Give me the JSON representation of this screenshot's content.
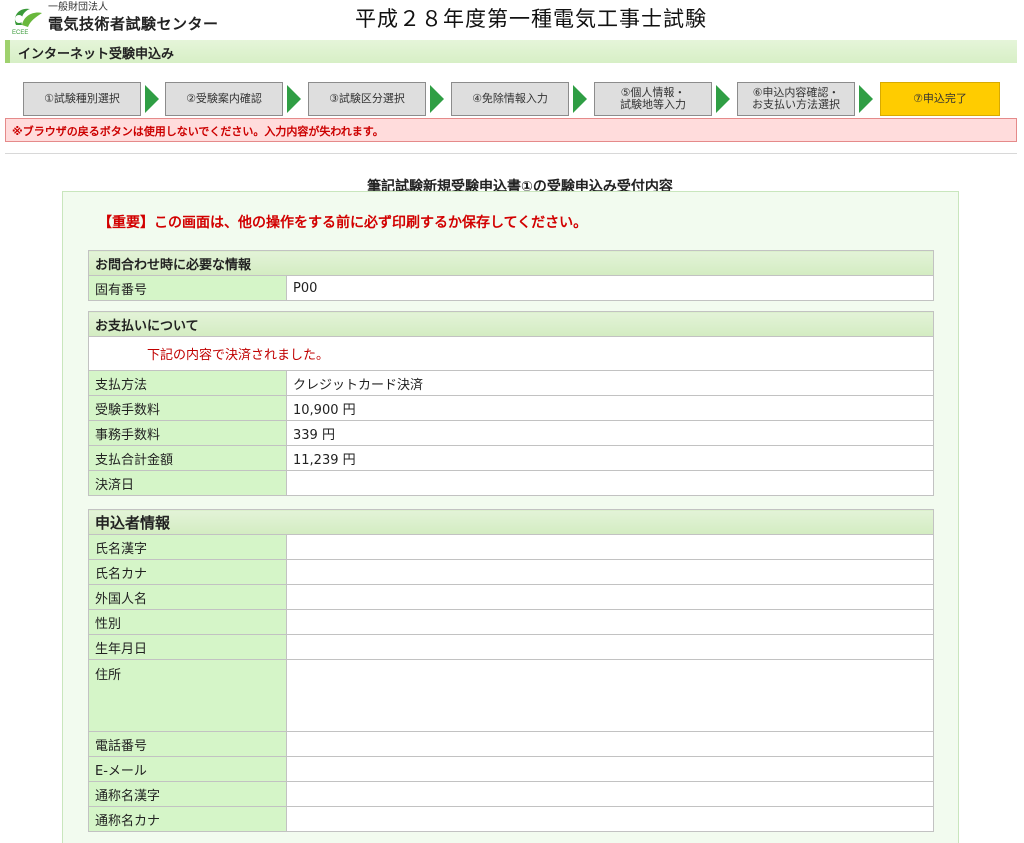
{
  "header": {
    "org_sub": "一般財団法人",
    "org_name": "電気技術者試験センター",
    "exam_title": "平成２８年度第一種電気工事士試験",
    "colors": {
      "brand_green": "#3a9a3a"
    }
  },
  "section": {
    "title": "インターネット受験申込み"
  },
  "steps": [
    {
      "label": "①試験種別選択"
    },
    {
      "label": "②受験案内確認"
    },
    {
      "label": "③試験区分選択"
    },
    {
      "label": "④免除情報入力"
    },
    {
      "label": "⑤個人情報・\n試験地等入力"
    },
    {
      "label": "⑥申込内容確認・\nお支払い方法選択"
    },
    {
      "label": "⑦申込完了"
    }
  ],
  "warning": "※ブラウザの戻るボタンは使用しないでください。入力内容が失われます。",
  "receipt_title": "筆記試験新規受験申込書①の受験申込み受付内容",
  "important": "【重要】この画面は、他の操作をする前に必ず印刷するか保存してください。",
  "contact": {
    "heading": "お問合わせ時に必要な情報",
    "id_label": "固有番号",
    "id_value": "P00"
  },
  "payment": {
    "heading": "お支払いについて",
    "notice": "下記の内容で決済されました。",
    "rows": [
      {
        "label": "支払方法",
        "value": "クレジットカード決済"
      },
      {
        "label": "受験手数料",
        "value": "10,900 円"
      },
      {
        "label": "事務手数料",
        "value": "339 円"
      },
      {
        "label": "支払合計金額",
        "value": "11,239 円"
      },
      {
        "label": "決済日",
        "value": ""
      }
    ]
  },
  "applicant": {
    "heading": "申込者情報",
    "rows": [
      {
        "label": "氏名漢字",
        "value": ""
      },
      {
        "label": "氏名カナ",
        "value": ""
      },
      {
        "label": "外国人名",
        "value": ""
      },
      {
        "label": "性別",
        "value": ""
      },
      {
        "label": "生年月日",
        "value": ""
      },
      {
        "label": "住所",
        "value": ""
      },
      {
        "label": "電話番号",
        "value": ""
      },
      {
        "label": "E-メール",
        "value": ""
      },
      {
        "label": "通称名漢字",
        "value": ""
      },
      {
        "label": "通称名カナ",
        "value": ""
      }
    ]
  }
}
